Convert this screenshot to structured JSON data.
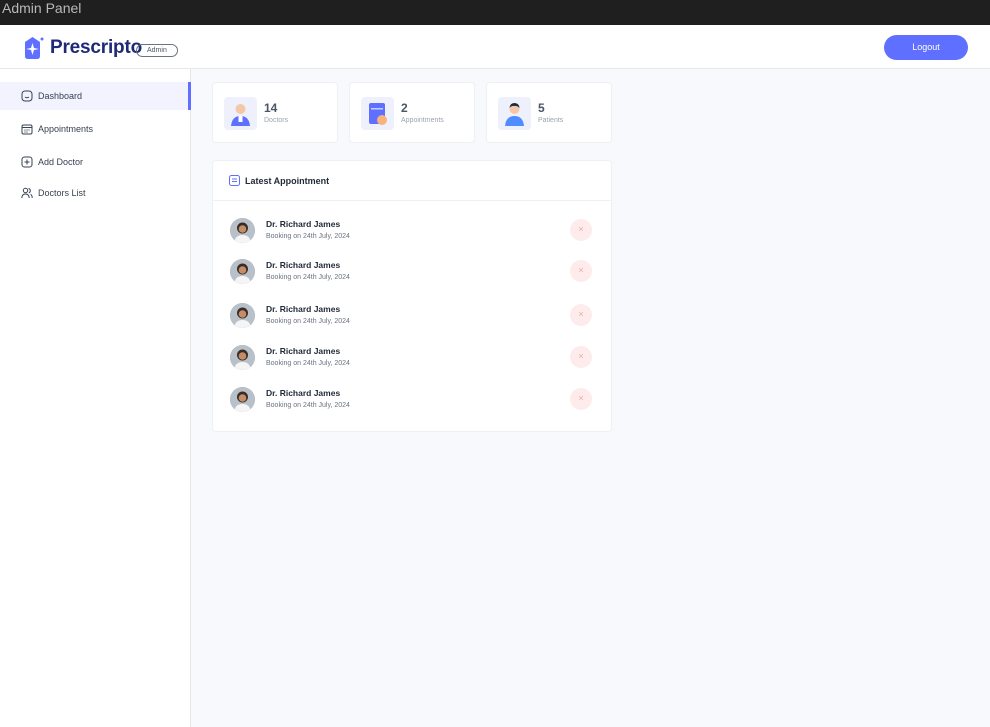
{
  "window": {
    "title": "Admin Panel"
  },
  "header": {
    "brand": "Prescripto",
    "badge": "Admin",
    "logout_label": "Logout"
  },
  "sidebar": {
    "items": [
      {
        "label": "Dashboard",
        "icon": "home-icon",
        "active": true
      },
      {
        "label": "Appointments",
        "icon": "calendar-icon",
        "active": false
      },
      {
        "label": "Add Doctor",
        "icon": "add-icon",
        "active": false
      },
      {
        "label": "Doctors List",
        "icon": "people-icon",
        "active": false
      }
    ]
  },
  "stats": [
    {
      "value": "14",
      "label": "Doctors",
      "icon": "doctor-icon"
    },
    {
      "value": "2",
      "label": "Appointments",
      "icon": "appointments-icon"
    },
    {
      "value": "5",
      "label": "Patients",
      "icon": "patient-icon"
    }
  ],
  "latest": {
    "title": "Latest Appointment",
    "items": [
      {
        "name": "Dr. Richard James",
        "date": "Booking on 24th July, 2024",
        "action": "×"
      },
      {
        "name": "Dr. Richard James",
        "date": "Booking on 24th July, 2024",
        "action": "×"
      },
      {
        "name": "Dr. Richard James",
        "date": "Booking on 24th July, 2024",
        "action": "×"
      },
      {
        "name": "Dr. Richard James",
        "date": "Booking on 24th July, 2024",
        "action": "×"
      },
      {
        "name": "Dr. Richard James",
        "date": "Booking on 24th July, 2024",
        "action": "×"
      }
    ]
  },
  "colors": {
    "accent": "#5f6fff",
    "brand": "#1e2a78",
    "cancel_bg": "#fdeceb"
  }
}
